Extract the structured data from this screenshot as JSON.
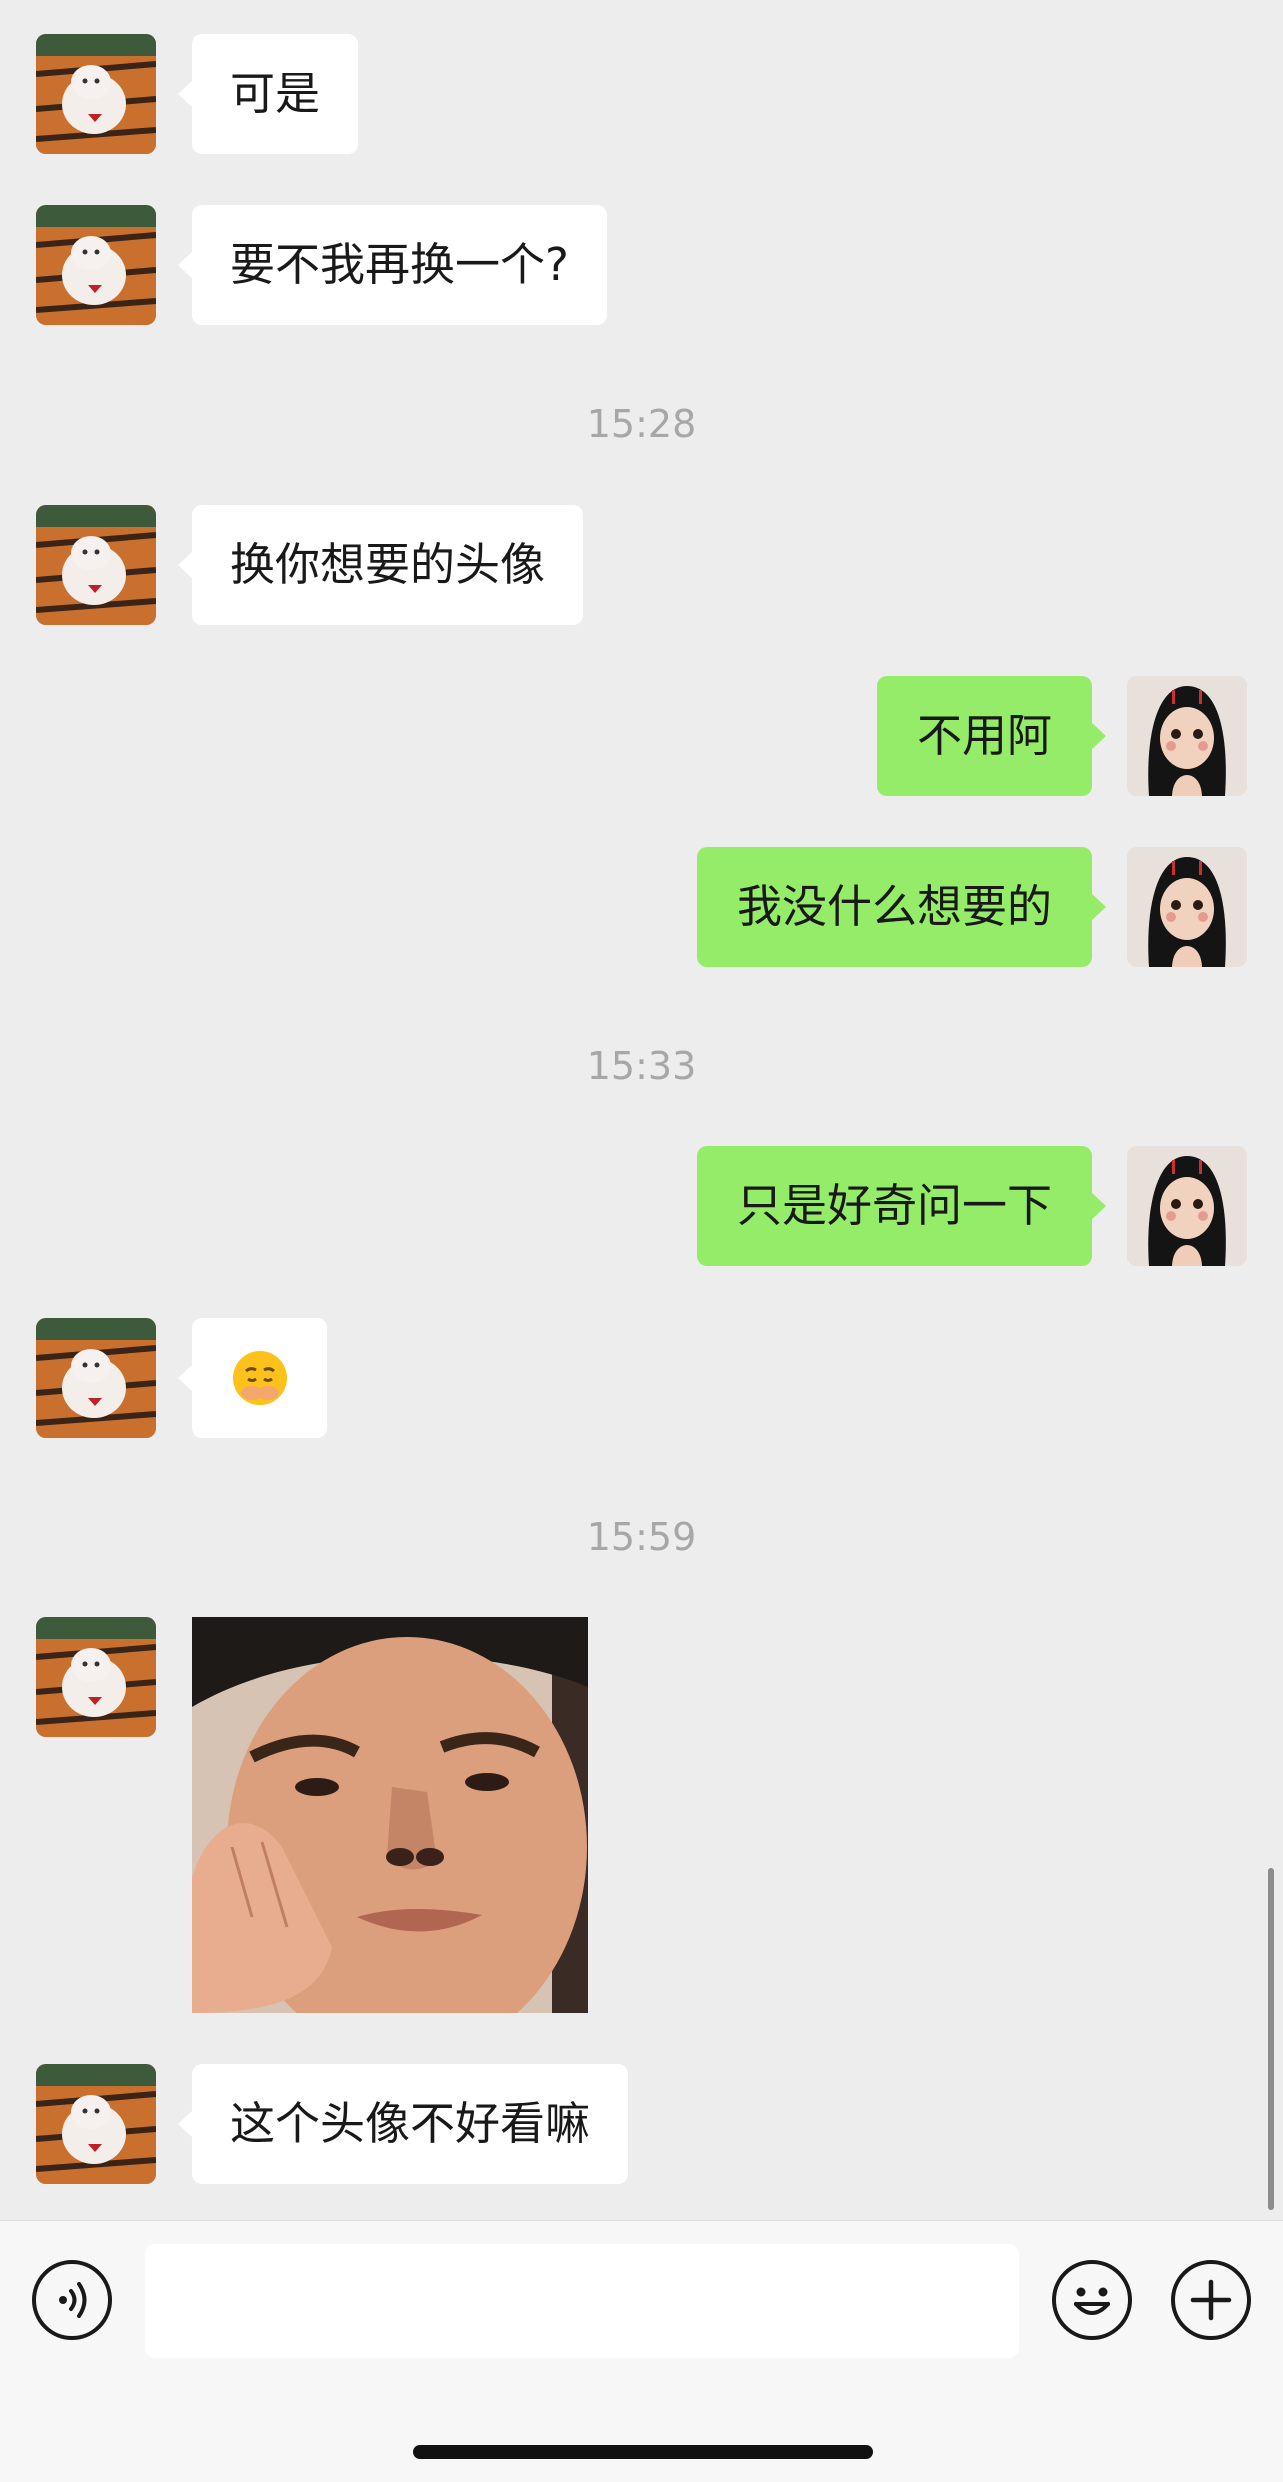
{
  "messages": {
    "m1": "可是",
    "m2": "要不我再换一个?",
    "m3": "换你想要的头像",
    "m4": "不用阿",
    "m5": "我没什么想要的",
    "m6": "只是好奇问一下",
    "m7": "😮",
    "m8": "这个头像不好看嘛"
  },
  "timestamps": {
    "t1": "15:28",
    "t2": "15:33",
    "t3": "15:59"
  },
  "input": {
    "value": "",
    "placeholder": ""
  },
  "icons": {
    "voice": "voice-mode-icon",
    "emoji": "emoji-icon",
    "plus": "plus-icon"
  },
  "colors": {
    "background": "#ededed",
    "incoming_bubble": "#ffffff",
    "outgoing_bubble": "#95ec69",
    "timestamp_text": "#a7a7a7"
  }
}
